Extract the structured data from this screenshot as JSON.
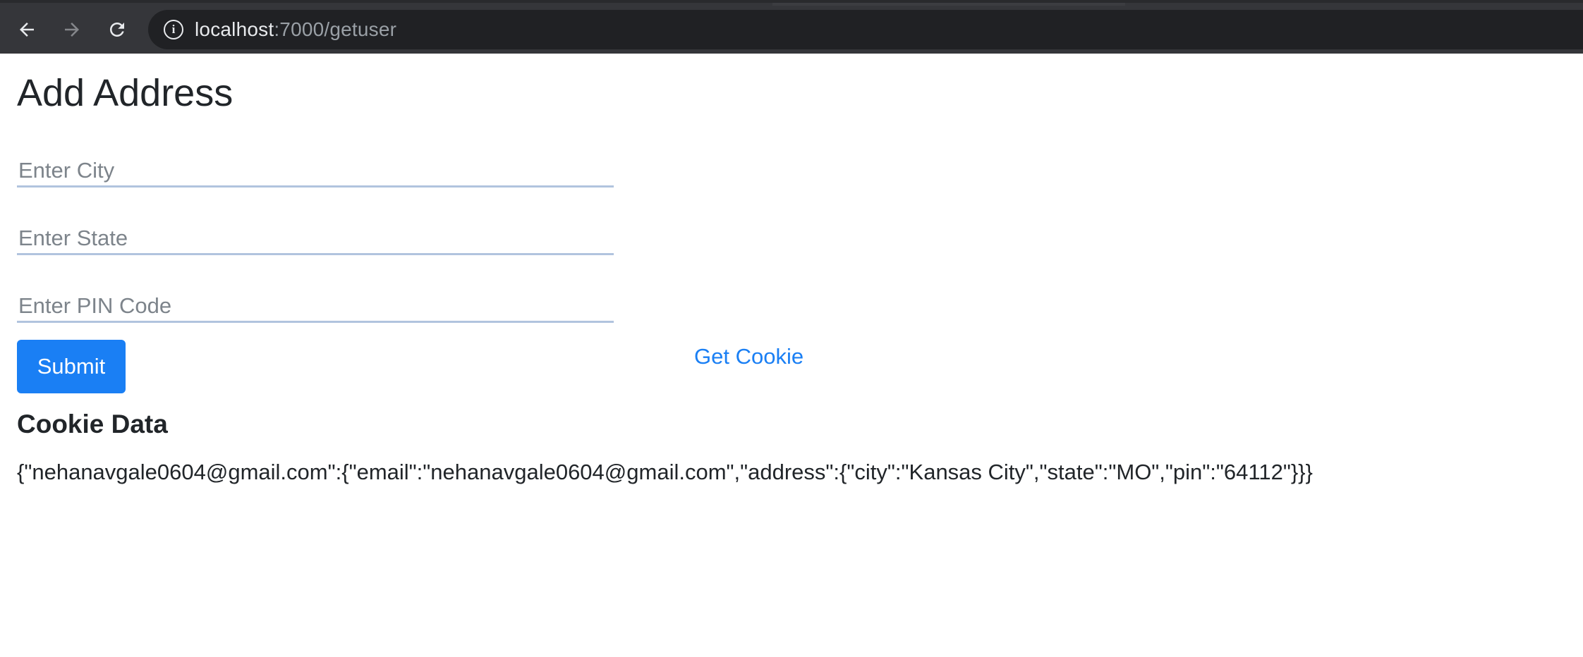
{
  "browser": {
    "url_host": "localhost",
    "url_path": ":7000/getuser",
    "info_glyph": "i"
  },
  "icons": {
    "back": "arrow-left-icon",
    "forward": "arrow-right-icon",
    "reload": "reload-icon",
    "info": "info-icon"
  },
  "colors": {
    "chrome_bg": "#35363a",
    "omnibox_bg": "#202124",
    "primary": "#1a7ff4",
    "field_underline": "#b1c4de",
    "text": "#212529"
  },
  "form": {
    "title": "Add Address",
    "city": {
      "placeholder": "Enter City",
      "value": ""
    },
    "state": {
      "placeholder": "Enter State",
      "value": ""
    },
    "pin": {
      "placeholder": "Enter PIN Code",
      "value": ""
    },
    "submit_label": "Submit"
  },
  "cookie": {
    "link_label": "Get Cookie",
    "heading": "Cookie Data",
    "data": "{\"nehanavgale0604@gmail.com\":{\"email\":\"nehanavgale0604@gmail.com\",\"address\":{\"city\":\"Kansas City\",\"state\":\"MO\",\"pin\":\"64112\"}}}"
  }
}
